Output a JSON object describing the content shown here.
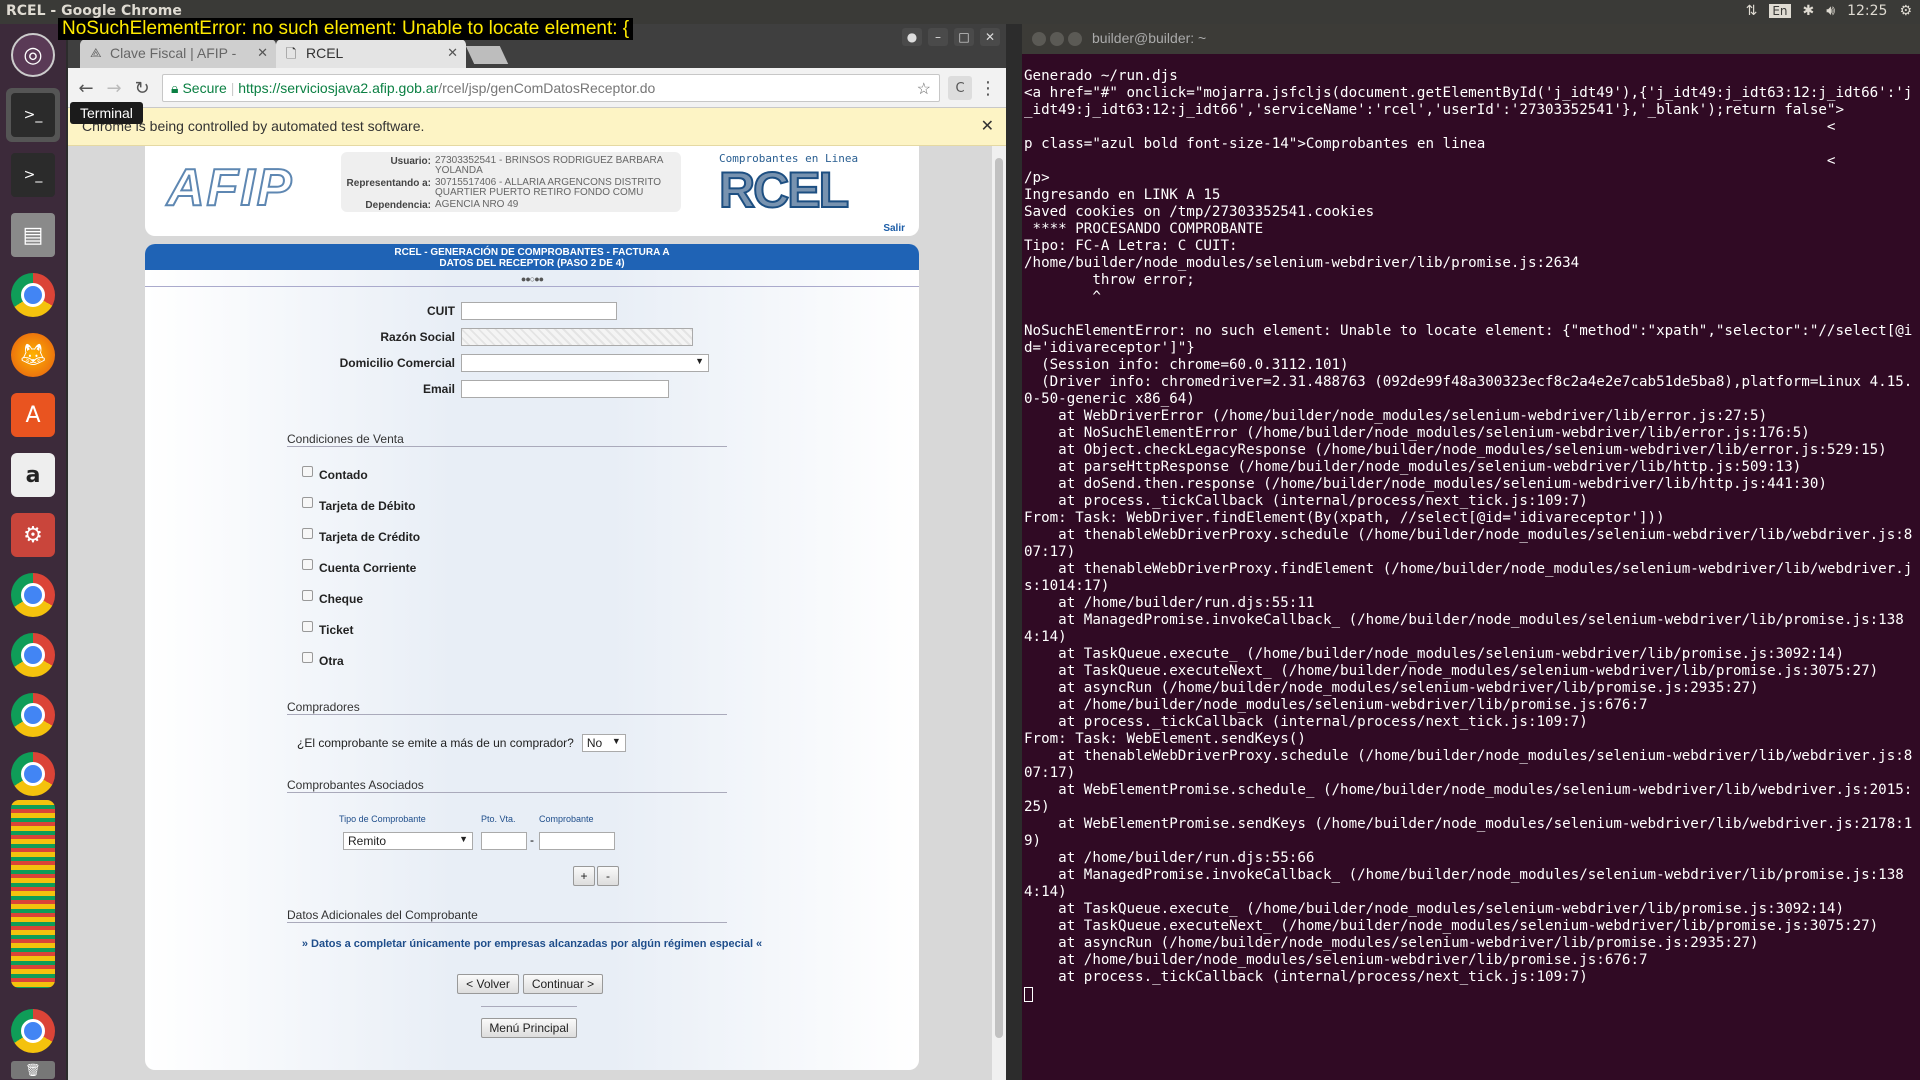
{
  "topbar": {
    "title": "RCEL - Google Chrome",
    "lang": "En",
    "time": "12:25"
  },
  "error_tooltip": "NoSuchElementError: no such element: Unable to locate element: {",
  "launcher": {
    "tooltip": "Terminal"
  },
  "chrome": {
    "tabs": [
      {
        "label": "Clave Fiscal | AFIP -",
        "active": false
      },
      {
        "label": "RCEL",
        "active": true
      }
    ],
    "address": {
      "secure": "Secure",
      "domain": "https://serviciosjava2.afip.gob.ar",
      "path": "/rcel/jsp/genComDatosReceptor.do"
    },
    "infobar": "Chrome is being controlled by automated test software."
  },
  "page": {
    "header": {
      "logo": "AFIP",
      "usuario_label": "Usuario:",
      "usuario": "27303352541 - BRINSOS RODRIGUEZ BARBARA YOLANDA",
      "representando_label": "Representando a:",
      "representando": "30715517406 - ALLARIA ARGENCONS DISTRITO QUARTIER PUERTO RETIRO FONDO COMU",
      "dependencia_label": "Dependencia:",
      "dependencia": "AGENCIA NRO 49",
      "rcel_small": "Comprobantes en Linea",
      "rcel_big": "RCEL",
      "salir": "Salir"
    },
    "form_title_1": "RCEL - GENERACIÓN DE COMPROBANTES - FACTURA A",
    "form_title_2": "DATOS DEL RECEPTOR (PASO 2 DE 4)",
    "steps": "●●○●●",
    "fields": {
      "cuit": "CUIT",
      "razon": "Razón Social",
      "domicilio": "Domicilio Comercial",
      "email": "Email"
    },
    "condiciones_title": "Condiciones de Venta",
    "condiciones": [
      "Contado",
      "Tarjeta de Débito",
      "Tarjeta de Crédito",
      "Cuenta Corriente",
      "Cheque",
      "Ticket",
      "Otra"
    ],
    "compradores_title": "Compradores",
    "compradores_question": "¿El comprobante se emite a más de un comprador?",
    "compradores_value": "No",
    "asociados_title": "Comprobantes Asociados",
    "asociados_cols": [
      "Tipo de Comprobante",
      "Pto. Vta.",
      "Comprobante"
    ],
    "asociados_tipo": "Remito",
    "asociados_sep": "-",
    "btn_plus": "+",
    "btn_minus": "-",
    "adicionales_title": "Datos Adicionales del Comprobante",
    "adicionales_link": "» Datos a completar únicamente por empresas alcanzadas por algún régimen especial «",
    "btn_volver": "< Volver",
    "btn_continuar": "Continuar >",
    "btn_menu": "Menú Principal"
  },
  "terminal": {
    "title": "builder@builder: ~",
    "output": "Generado ~/run.djs\n<a href=\"#\" onclick=\"mojarra.jsfcljs(document.getElementById('j_idt49'),{'j_idt49:j_idt63:12:j_idt66':'j_idt49:j_idt63:12:j_idt66','serviceName':'rcel','userId':'27303352541'},'_blank');return false\">\n                                                                                              <\np class=\"azul bold font-size-14\">Comprobantes en linea\n                                                                                              <\n/p>\nIngresando en LINK A 15\nSaved cookies on /tmp/27303352541.cookies\n **** PROCESANDO COMPROBANTE\nTipo: FC-A Letra: C CUIT:\n/home/builder/node_modules/selenium-webdriver/lib/promise.js:2634\n        throw error;\n        ^\n\nNoSuchElementError: no such element: Unable to locate element: {\"method\":\"xpath\",\"selector\":\"//select[@id='idivareceptor']\"}\n  (Session info: chrome=60.0.3112.101)\n  (Driver info: chromedriver=2.31.488763 (092de99f48a300323ecf8c2a4e2e7cab51de5ba8),platform=Linux 4.15.0-50-generic x86_64)\n    at WebDriverError (/home/builder/node_modules/selenium-webdriver/lib/error.js:27:5)\n    at NoSuchElementError (/home/builder/node_modules/selenium-webdriver/lib/error.js:176:5)\n    at Object.checkLegacyResponse (/home/builder/node_modules/selenium-webdriver/lib/error.js:529:15)\n    at parseHttpResponse (/home/builder/node_modules/selenium-webdriver/lib/http.js:509:13)\n    at doSend.then.response (/home/builder/node_modules/selenium-webdriver/lib/http.js:441:30)\n    at process._tickCallback (internal/process/next_tick.js:109:7)\nFrom: Task: WebDriver.findElement(By(xpath, //select[@id='idivareceptor']))\n    at thenableWebDriverProxy.schedule (/home/builder/node_modules/selenium-webdriver/lib/webdriver.js:807:17)\n    at thenableWebDriverProxy.findElement (/home/builder/node_modules/selenium-webdriver/lib/webdriver.js:1014:17)\n    at /home/builder/run.djs:55:11\n    at ManagedPromise.invokeCallback_ (/home/builder/node_modules/selenium-webdriver/lib/promise.js:1384:14)\n    at TaskQueue.execute_ (/home/builder/node_modules/selenium-webdriver/lib/promise.js:3092:14)\n    at TaskQueue.executeNext_ (/home/builder/node_modules/selenium-webdriver/lib/promise.js:3075:27)\n    at asyncRun (/home/builder/node_modules/selenium-webdriver/lib/promise.js:2935:27)\n    at /home/builder/node_modules/selenium-webdriver/lib/promise.js:676:7\n    at process._tickCallback (internal/process/next_tick.js:109:7)\nFrom: Task: WebElement.sendKeys()\n    at thenableWebDriverProxy.schedule (/home/builder/node_modules/selenium-webdriver/lib/webdriver.js:807:17)\n    at WebElementPromise.schedule_ (/home/builder/node_modules/selenium-webdriver/lib/webdriver.js:2015:25)\n    at WebElementPromise.sendKeys (/home/builder/node_modules/selenium-webdriver/lib/webdriver.js:2178:19)\n    at /home/builder/run.djs:55:66\n    at ManagedPromise.invokeCallback_ (/home/builder/node_modules/selenium-webdriver/lib/promise.js:1384:14)\n    at TaskQueue.execute_ (/home/builder/node_modules/selenium-webdriver/lib/promise.js:3092:14)\n    at TaskQueue.executeNext_ (/home/builder/node_modules/selenium-webdriver/lib/promise.js:3075:27)\n    at asyncRun (/home/builder/node_modules/selenium-webdriver/lib/promise.js:2935:27)\n    at /home/builder/node_modules/selenium-webdriver/lib/promise.js:676:7\n    at process._tickCallback (internal/process/next_tick.js:109:7)\n"
  }
}
